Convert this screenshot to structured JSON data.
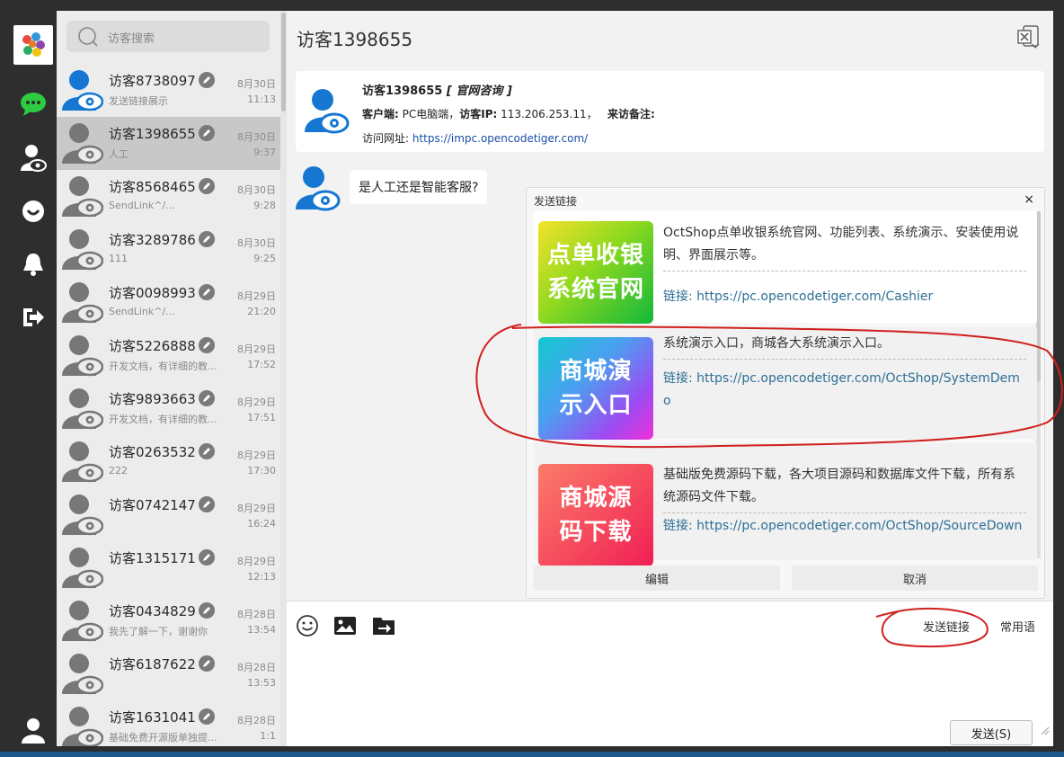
{
  "sidebar": {
    "items": [
      {
        "name": "chat-icon",
        "color": "#2ecc40"
      },
      {
        "name": "visitor-icon"
      },
      {
        "name": "robot-icon"
      },
      {
        "name": "bell-icon"
      },
      {
        "name": "logout-icon"
      },
      {
        "name": "user-icon"
      }
    ]
  },
  "search": {
    "placeholder": "访客搜索"
  },
  "conversations": [
    {
      "name": "访客8738097",
      "preview": "发送链接展示",
      "date": "8月30日",
      "time": "11:13"
    },
    {
      "name": "访客1398655",
      "preview": "人工",
      "date": "8月30日",
      "time": "9:37",
      "active": true
    },
    {
      "name": "访客8568465",
      "preview": "SendLink^/...",
      "date": "8月30日",
      "time": "9:28"
    },
    {
      "name": "访客3289786",
      "preview": "111",
      "date": "8月30日",
      "time": "9:25"
    },
    {
      "name": "访客0098993",
      "preview": "SendLink^/...",
      "date": "8月29日",
      "time": "21:20"
    },
    {
      "name": "访客5226888",
      "preview": "开发文档，有详细的教...",
      "date": "8月29日",
      "time": "17:52"
    },
    {
      "name": "访客9893663",
      "preview": "开发文档，有详细的教...",
      "date": "8月29日",
      "time": "17:51"
    },
    {
      "name": "访客0263532",
      "preview": "222",
      "date": "8月29日",
      "time": "17:30"
    },
    {
      "name": "访客0742147",
      "preview": "",
      "date": "8月29日",
      "time": "16:24"
    },
    {
      "name": "访客1315171",
      "preview": "",
      "date": "8月29日",
      "time": "12:13"
    },
    {
      "name": "访客0434829",
      "preview": "我先了解一下，谢谢你",
      "date": "8月28日",
      "time": "13:54"
    },
    {
      "name": "访客6187622",
      "preview": "",
      "date": "8月28日",
      "time": "13:53"
    },
    {
      "name": "访客1631041",
      "preview": "基础免费开源版单独提...",
      "date": "8月28日",
      "time": "1:1"
    }
  ],
  "chat": {
    "title": "访客1398655",
    "info": {
      "visitor": "访客1398655",
      "source": "[ 官网咨询 ]",
      "client_label": "客户端:",
      "client_value": "PC电脑端，",
      "ip_label": "访客IP:",
      "ip_value": "113.206.253.11，",
      "remark_label": "来访备注:",
      "url_label": "访问网址:",
      "url_value": "https://impc.opencodetiger.com/"
    },
    "message": "是人工还是智能客服?"
  },
  "popup": {
    "title": "发送链接",
    "close": "×",
    "links": [
      {
        "thumb": "点单收银系统官网",
        "thumb_l1": "点单收银",
        "thumb_l2": "系统官网",
        "desc": "OctShop点单收银系统官网、功能列表、系统演示、安装使用说明、界面展示等。",
        "url_label": "链接:",
        "url": "https://pc.opencodetiger.com/Cashier"
      },
      {
        "thumb": "商城演示入口",
        "thumb_l1": "商城演",
        "thumb_l2": "示入口",
        "desc": "系统演示入口，商城各大系统演示入口。",
        "url_label": "链接:",
        "url": "https://pc.opencodetiger.com/OctShop/SystemDemo"
      },
      {
        "thumb": "商城源码下载",
        "thumb_l1": "商城源",
        "thumb_l2": "码下载",
        "desc": "基础版免费源码下载，各大项目源码和数据库文件下载，所有系统源码文件下载。",
        "url_label": "链接:",
        "url": "https://pc.opencodetiger.com/OctShop/SourceDown"
      }
    ],
    "edit_label": "编辑",
    "cancel_label": "取消"
  },
  "composer": {
    "tools": [
      "emoji-icon",
      "image-icon",
      "file-send-icon"
    ],
    "send_link_label": "发送链接",
    "common_phrases_label": "常用语",
    "send_label": "发送(S)"
  },
  "colors": {
    "accent_green": "#2ecc40",
    "avatar_blue": "#1677d2",
    "link_blue": "#2e6f96",
    "annotation_red": "#d0201e"
  }
}
